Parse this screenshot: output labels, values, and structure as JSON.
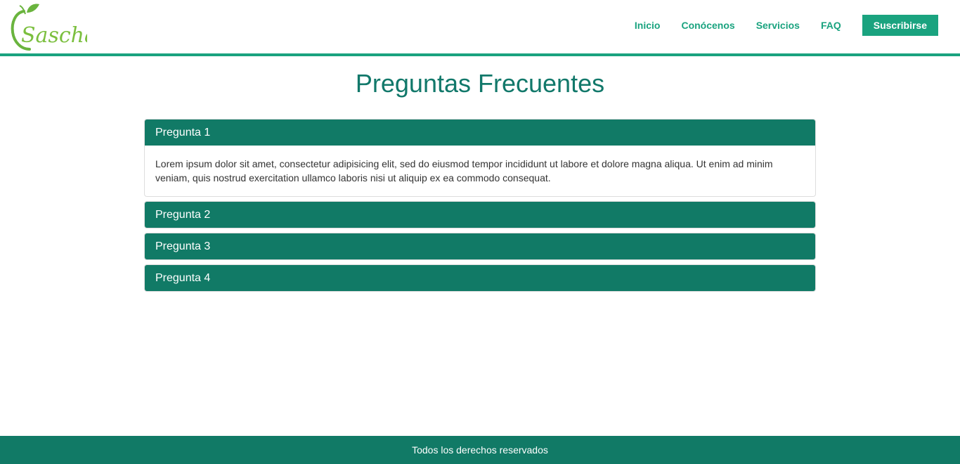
{
  "brand": {
    "logo_text": "Sascha",
    "accent_color": "#1aa37f",
    "dark_color": "#117a66"
  },
  "nav": {
    "items": [
      "Inicio",
      "Conócenos",
      "Servicios",
      "FAQ"
    ],
    "subscribe_label": "Suscribirse"
  },
  "page": {
    "title": "Preguntas Frecuentes"
  },
  "faq": {
    "items": [
      {
        "question": "Pregunta 1",
        "answer": "Lorem ipsum dolor sit amet, consectetur adipisicing elit, sed do eiusmod tempor incididunt ut labore et dolore magna aliqua. Ut enim ad minim veniam, quis nostrud exercitation ullamco laboris nisi ut aliquip ex ea commodo consequat.",
        "expanded": true
      },
      {
        "question": "Pregunta 2",
        "expanded": false
      },
      {
        "question": "Pregunta 3",
        "expanded": false
      },
      {
        "question": "Pregunta 4",
        "expanded": false
      }
    ]
  },
  "footer": {
    "text": "Todos los derechos reservados"
  }
}
